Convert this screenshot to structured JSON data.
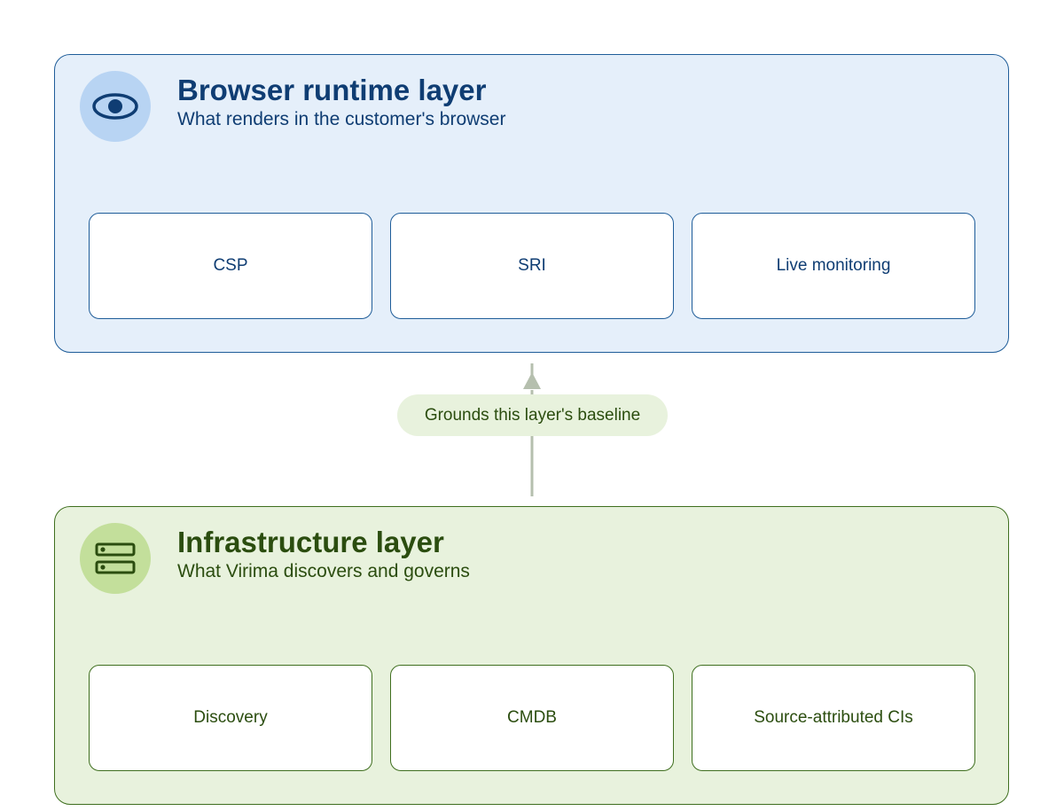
{
  "browser_layer": {
    "icon": "eye-icon",
    "title": "Browser runtime layer",
    "subtitle": "What renders in the customer's browser",
    "cards": [
      "CSP",
      "SRI",
      "Live monitoring"
    ],
    "accent": "#1f5d99",
    "fill": "#e5effa"
  },
  "connector": {
    "label": "Grounds this layer's baseline",
    "direction": "up",
    "color": "#b5bfae"
  },
  "infra_layer": {
    "icon": "server-icon",
    "title": "Infrastructure layer",
    "subtitle": "What Virima discovers and governs",
    "cards": [
      "Discovery",
      "CMDB",
      "Source-attributed CIs"
    ],
    "accent": "#3f6f1f",
    "fill": "#e8f2dd"
  }
}
